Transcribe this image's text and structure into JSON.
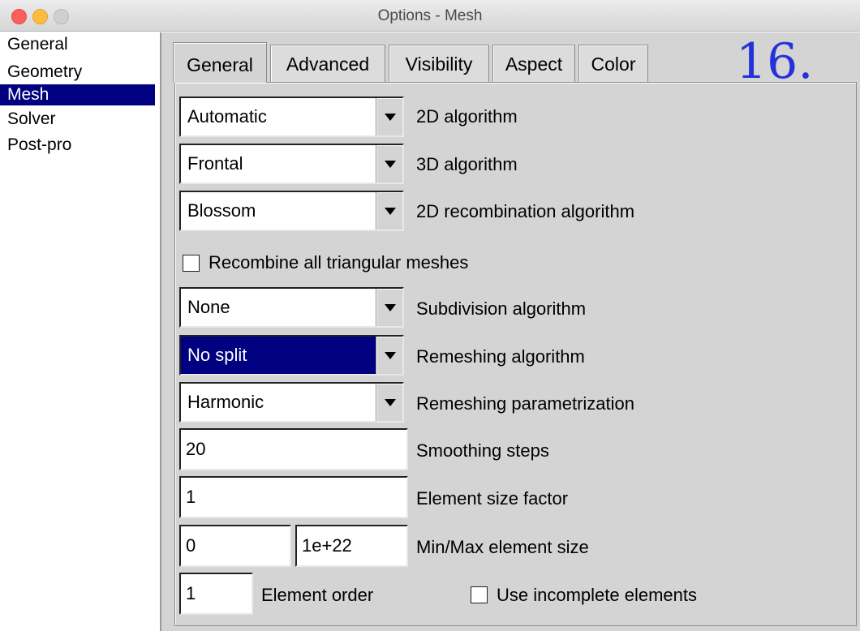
{
  "window": {
    "title": "Options - Mesh"
  },
  "categories": [
    "General",
    "Geometry",
    "Mesh",
    "Solver",
    "Post-pro"
  ],
  "selected_category": "Mesh",
  "tabs": [
    {
      "label": "General",
      "active": true
    },
    {
      "label": "Advanced",
      "active": false
    },
    {
      "label": "Visibility",
      "active": false
    },
    {
      "label": "Aspect",
      "active": false
    },
    {
      "label": "Color",
      "active": false
    }
  ],
  "annotation": "16.",
  "general": {
    "algo_2d": {
      "value": "Automatic",
      "label": "2D algorithm"
    },
    "algo_3d": {
      "value": "Frontal",
      "label": "3D algorithm"
    },
    "recomb_2d": {
      "value": "Blossom",
      "label": "2D recombination algorithm"
    },
    "recombine_all": {
      "label": "Recombine all triangular meshes",
      "checked": false
    },
    "subdivision": {
      "value": "None",
      "label": "Subdivision algorithm"
    },
    "remeshing": {
      "value": "No split",
      "label": "Remeshing algorithm"
    },
    "remesh_param": {
      "value": "Harmonic",
      "label": "Remeshing parametrization"
    },
    "smoothing_steps": {
      "value": "20",
      "label": "Smoothing steps"
    },
    "size_factor": {
      "value": "1",
      "label": "Element size factor"
    },
    "min_max_size": {
      "min": "0",
      "max": "1e+22",
      "label": "Min/Max element size"
    },
    "element_order": {
      "value": "1",
      "label": "Element order"
    },
    "incomplete": {
      "label": "Use incomplete elements",
      "checked": false
    }
  },
  "colors": {
    "selection": "#000080",
    "panel": "#d4d4d4",
    "annotation": "#2432d8"
  }
}
